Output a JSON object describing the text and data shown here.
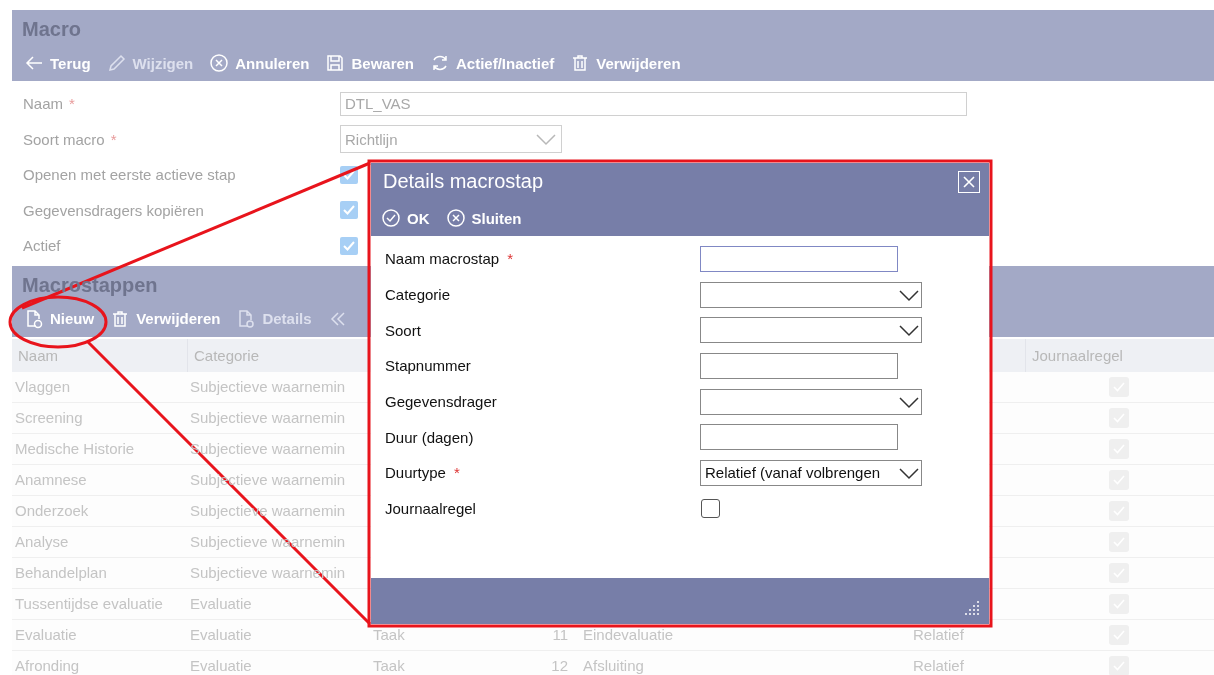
{
  "macro": {
    "title": "Macro",
    "toolbar": [
      {
        "kind": "back",
        "label": "Terug",
        "disabled": false
      },
      {
        "kind": "edit",
        "label": "Wijzigen",
        "disabled": true
      },
      {
        "kind": "cancel",
        "label": "Annuleren",
        "disabled": false
      },
      {
        "kind": "save",
        "label": "Bewaren",
        "disabled": false
      },
      {
        "kind": "toggle",
        "label": "Actief/Inactief",
        "disabled": false
      },
      {
        "kind": "delete",
        "label": "Verwijderen",
        "disabled": false
      }
    ],
    "fields": [
      {
        "kind": "text",
        "label": "Naam",
        "required_mark": "*",
        "value": "DTL_VAS"
      },
      {
        "kind": "select",
        "label": "Soort macro",
        "required_mark": "*",
        "value": "Richtlijn"
      },
      {
        "kind": "checkbox",
        "label": "Openen met eerste actieve stap",
        "checked": true
      },
      {
        "kind": "checkbox",
        "label": "Gegevensdragers kopiëren",
        "checked": true
      },
      {
        "kind": "checkbox",
        "label": "Actief",
        "checked": true
      }
    ]
  },
  "steps": {
    "title": "Macrostappen",
    "toolbar": [
      {
        "kind": "new",
        "label": "Nieuw",
        "disabled": false
      },
      {
        "kind": "delete",
        "label": "Verwijderen",
        "disabled": false
      },
      {
        "kind": "details",
        "label": "Details",
        "disabled": true
      },
      {
        "kind": "collapse",
        "disabled": true
      }
    ],
    "columns": [
      "Naam",
      "Categorie",
      "Journaalregel"
    ],
    "rows": [
      {
        "naam": "Vlaggen",
        "categorie": "Subjectieve waarnemin",
        "journaalregel": true
      },
      {
        "naam": "Screening",
        "categorie": "Subjectieve waarnemin",
        "journaalregel": true
      },
      {
        "naam": "Medische Historie",
        "categorie": "Subjectieve waarnemin",
        "journaalregel": true
      },
      {
        "naam": "Anamnese",
        "categorie": "Subjectieve waarnemin",
        "journaalregel": true
      },
      {
        "naam": "Onderzoek",
        "categorie": "Subjectieve waarnemin",
        "journaalregel": true
      },
      {
        "naam": "Analyse",
        "categorie": "Subjectieve waarnemin",
        "journaalregel": true
      },
      {
        "naam": "Behandelplan",
        "categorie": "Subjectieve waarnemin",
        "journaalregel": true
      },
      {
        "naam": "Tussentijdse evaluatie",
        "categorie": "Evaluatie",
        "journaalregel": true
      },
      {
        "naam": "Evaluatie",
        "categorie": "Evaluatie",
        "column_3": "Taak",
        "column_4": "11",
        "column_5": "Eindevaluatie",
        "column_6": "Relatief",
        "journaalregel": true
      },
      {
        "naam": "Afronding",
        "categorie": "Evaluatie",
        "column_3": "Taak",
        "column_4": "12",
        "column_5": "Afsluiting",
        "column_6": "Relatief",
        "journaalregel": true
      }
    ]
  },
  "dialog": {
    "title": "Details macrostap",
    "toolbar": [
      {
        "kind": "ok",
        "label": "OK"
      },
      {
        "kind": "close",
        "label": "Sluiten"
      }
    ],
    "fields": [
      {
        "kind": "text",
        "label": "Naam macrostap",
        "required_mark": "*",
        "focused": true
      },
      {
        "kind": "select",
        "label": "Categorie"
      },
      {
        "kind": "select",
        "label": "Soort"
      },
      {
        "kind": "text",
        "label": "Stapnummer"
      },
      {
        "kind": "select",
        "label": "Gegevensdrager"
      },
      {
        "kind": "text",
        "label": "Duur (dagen)"
      },
      {
        "kind": "select",
        "label": "Duurtype",
        "required_mark": "*",
        "value": "Relatief (vanaf volbrengen"
      },
      {
        "kind": "checkbox",
        "label": "Journaalregel",
        "checked": false
      }
    ]
  }
}
